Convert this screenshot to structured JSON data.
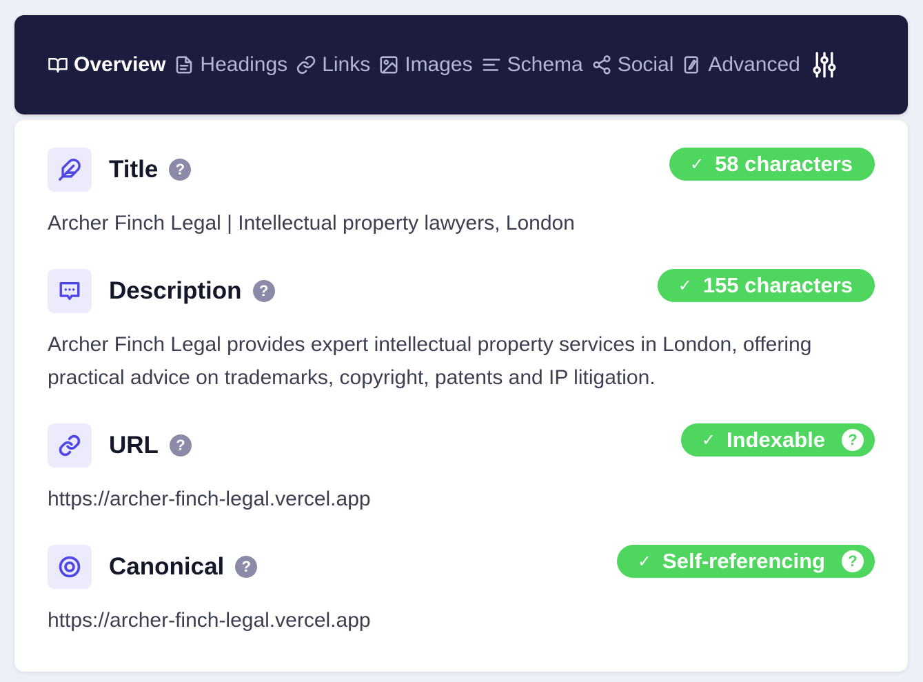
{
  "nav": {
    "tabs": [
      {
        "label": "Overview",
        "icon": "book-open-icon",
        "active": true
      },
      {
        "label": "Headings",
        "icon": "document-icon"
      },
      {
        "label": "Links",
        "icon": "link-icon"
      },
      {
        "label": "Images",
        "icon": "image-icon"
      },
      {
        "label": "Schema",
        "icon": "align-left-icon"
      },
      {
        "label": "Social",
        "icon": "share-icon"
      },
      {
        "label": "Advanced",
        "icon": "advanced-icon"
      }
    ],
    "settings_icon": "sliders-icon"
  },
  "sections": {
    "title": {
      "heading": "Title",
      "badge": "58 characters",
      "text": "Archer Finch Legal | Intellectual property lawyers, London",
      "icon": "feather-icon"
    },
    "description": {
      "heading": "Description",
      "badge": "155 characters",
      "text": "Archer Finch Legal provides expert intellectual property services in London, offering practical advice on trademarks, copyright, patents and IP litigation.",
      "icon": "message-icon"
    },
    "url": {
      "heading": "URL",
      "badge": "Indexable",
      "text": "https://archer-finch-legal.vercel.app",
      "icon": "link-icon"
    },
    "canonical": {
      "heading": "Canonical",
      "badge": "Self-referencing",
      "text": "https://archer-finch-legal.vercel.app",
      "icon": "target-icon"
    }
  },
  "symbols": {
    "help": "?",
    "check": "✓"
  },
  "colors": {
    "nav_bg": "#1c1c3e",
    "accent": "#4f46e5",
    "success": "#4ed65f",
    "icon_bg": "#ecebfc",
    "help": "#8b8ba8"
  }
}
